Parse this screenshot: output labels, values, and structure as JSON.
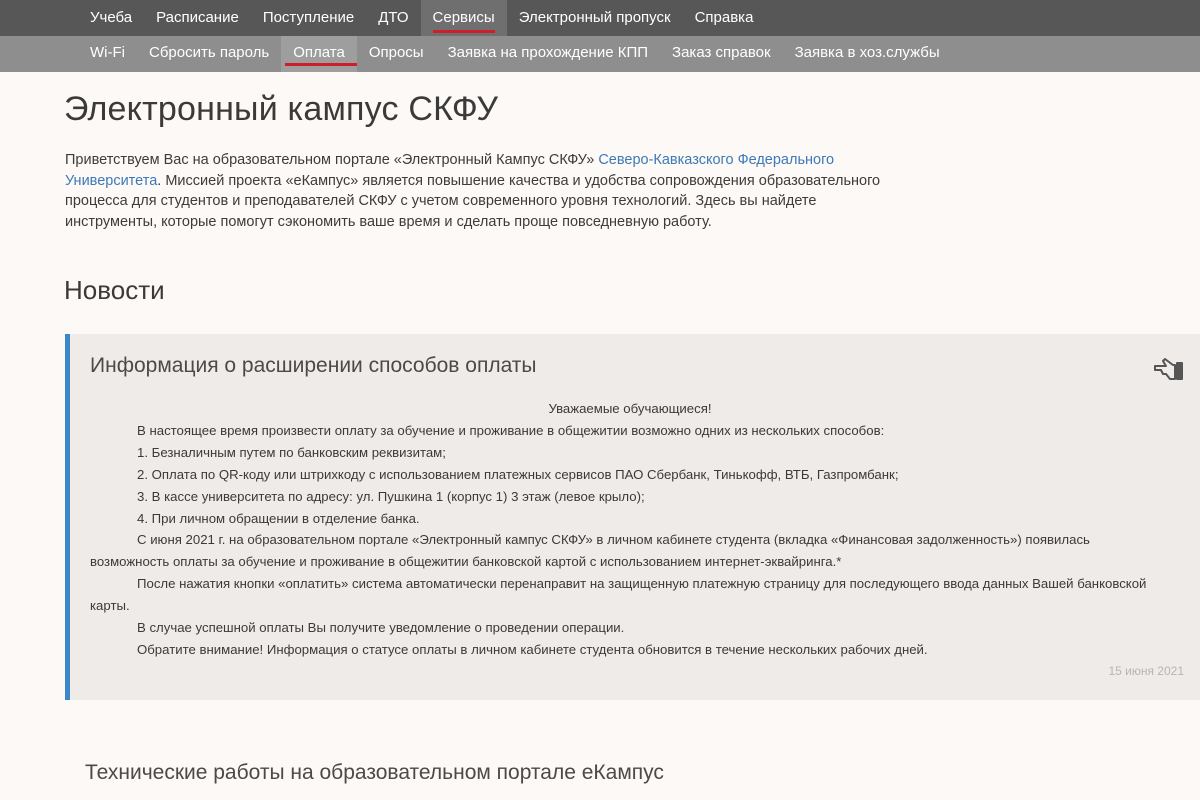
{
  "top_nav": [
    {
      "label": "Учеба",
      "active": false
    },
    {
      "label": "Расписание",
      "active": false
    },
    {
      "label": "Поступление",
      "active": false
    },
    {
      "label": "ДТО",
      "active": false
    },
    {
      "label": "Сервисы",
      "active": true
    },
    {
      "label": "Электронный пропуск",
      "active": false
    },
    {
      "label": "Справка",
      "active": false
    }
  ],
  "sub_nav": [
    {
      "label": "Wi-Fi",
      "active": false
    },
    {
      "label": "Сбросить пароль",
      "active": false
    },
    {
      "label": "Оплата",
      "active": true
    },
    {
      "label": "Опросы",
      "active": false
    },
    {
      "label": "Заявка на прохождение КПП",
      "active": false
    },
    {
      "label": "Заказ справок",
      "active": false
    },
    {
      "label": "Заявка в хоз.службы",
      "active": false
    }
  ],
  "page": {
    "title": "Электронный кампус СКФУ",
    "intro_before_link": "Приветствуем Вас на образовательном портале «Электронный Кампус СКФУ» ",
    "intro_link": "Северо-Кавказского Федерального Университета",
    "intro_after_link": ". Миссией проекта «еКампус» является повышение качества и удобства сопровождения образовательного процесса для студентов и преподавателей СКФУ с учетом современного уровня технологий. Здесь вы найдете инструменты, которые помогут сэкономить ваше время и сделать проще повседневную работу."
  },
  "news": {
    "heading": "Новости",
    "items": [
      {
        "title": "Информация о расширении способов оплаты",
        "pin_icon": "pin-icon",
        "greeting": "Уважаемые обучающиеся!",
        "paragraphs": [
          "В настоящее время произвести оплату за обучение и проживание в общежитии возможно одних из нескольких способов:",
          "1. Безналичным путем по банковским реквизитам;",
          "2. Оплата по QR-коду или штрихкоду с использованием платежных сервисов ПАО Сбербанк, Тинькофф, ВТБ, Газпромбанк;",
          "3. В кассе университета по адресу: ул. Пушкина 1 (корпус 1) 3 этаж (левое крыло);",
          "4. При личном обращении в отделение банка.",
          "С июня 2021 г. на образовательном портале «Электронный кампус СКФУ» в личном кабинете студента (вкладка «Финансовая задолженность») появилась возможность оплаты за обучение и проживание в общежитии банковской картой с использованием интернет-эквайринга.*",
          "После нажатия кнопки «оплатить» система автоматически перенаправит на защищенную платежную страницу для последующего ввода данных Вашей банковской карты.",
          "В случае успешной оплаты Вы получите уведомление о проведении операции.",
          "Обратите внимание! Информация о статусе оплаты в личном кабинете студента обновится в течение нескольких рабочих дней."
        ],
        "date": "15 июня 2021"
      },
      {
        "title": "Технические работы на образовательном портале еКампус"
      }
    ]
  },
  "colors": {
    "nav_bg": "#575757",
    "subnav_bg": "#8e8e8e",
    "active_underline": "#d01d2a",
    "card_border": "#3d87c8",
    "link": "#3e79b7"
  }
}
